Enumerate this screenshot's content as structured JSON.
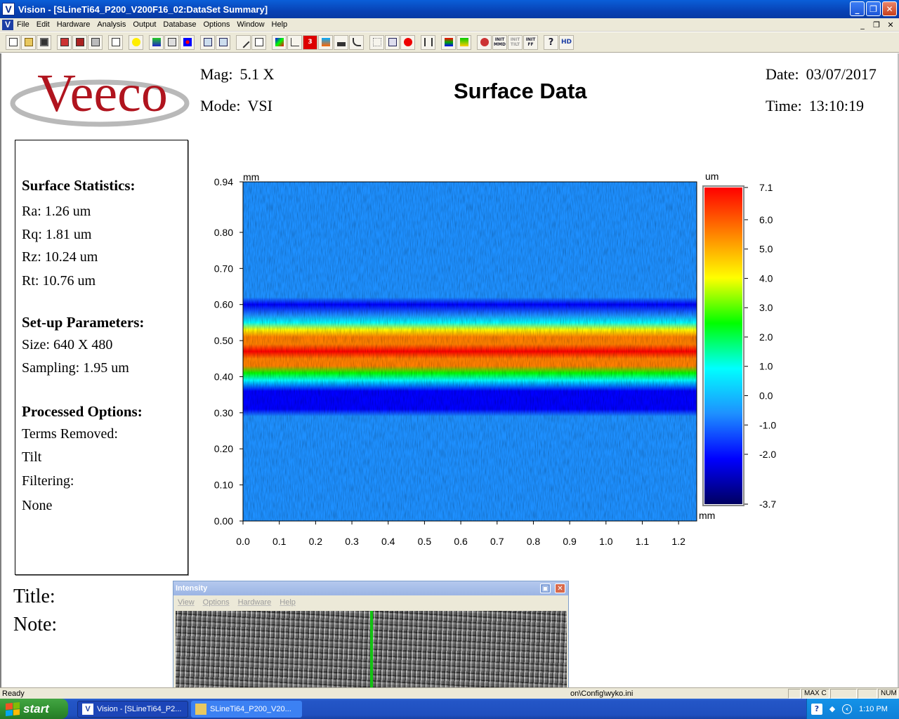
{
  "window": {
    "app_icon": "V",
    "title": "Vision - [SLineTi64_P200_V200F16_02:DataSet Summary]",
    "buttons": {
      "minimize": "_",
      "maximize": "❐",
      "close": "✕"
    }
  },
  "menubar": {
    "items": [
      "File",
      "Edit",
      "Hardware",
      "Analysis",
      "Output",
      "Database",
      "Options",
      "Window",
      "Help"
    ],
    "mdi": {
      "minimize": "_",
      "restore": "❐",
      "close": "✕"
    }
  },
  "toolbar": {
    "text_buttons": {
      "three_d": "3",
      "init_mmd": "INIT MMD",
      "init_tilt": "INIT TILT",
      "init_ff": "INIT FF",
      "help": "?",
      "hd": "HD"
    }
  },
  "report": {
    "logo_text": "Veeco",
    "mag_label": "Mag:",
    "mag_value": "5.1 X",
    "mode_label": "Mode:",
    "mode_value": "VSI",
    "title": "Surface Data",
    "date_label": "Date:",
    "date_value": "03/07/2017",
    "time_label": "Time:",
    "time_value": "13:10:19",
    "stats": {
      "heading": "Surface Statistics:",
      "ra": "Ra:  1.26 um",
      "rq": "Rq:  1.81 um",
      "rz": "Rz:  10.24 um",
      "rt": "Rt:  10.76 um"
    },
    "setup": {
      "heading": "Set-up Parameters:",
      "size": "Size: 640 X 480",
      "sampling": "Sampling:  1.95 um"
    },
    "processed": {
      "heading": "Processed Options:",
      "terms_label": "Terms Removed:",
      "terms_value": "Tilt",
      "filter_label": "Filtering:",
      "filter_value": "None"
    },
    "title_label": "Title:",
    "note_label": "Note:"
  },
  "chart_data": {
    "type": "heatmap",
    "x_unit": "mm",
    "y_unit": "mm",
    "z_unit": "um",
    "xlim": [
      0,
      1.25
    ],
    "ylim": [
      0,
      0.94
    ],
    "x_ticks": [
      "0.0",
      "0.1",
      "0.2",
      "0.3",
      "0.4",
      "0.5",
      "0.6",
      "0.7",
      "0.8",
      "0.9",
      "1.0",
      "1.1",
      "1.2"
    ],
    "y_ticks": [
      "0.00",
      "0.10",
      "0.20",
      "0.30",
      "0.40",
      "0.50",
      "0.60",
      "0.70",
      "0.80",
      "0.94"
    ],
    "y_tick_values": [
      0,
      0.1,
      0.2,
      0.3,
      0.4,
      0.5,
      0.6,
      0.7,
      0.8,
      0.94
    ],
    "zlim": [
      -3.7,
      7.1
    ],
    "colorbar_ticks": [
      "7.1",
      "6.0",
      "5.0",
      "4.0",
      "3.0",
      "2.0",
      "1.0",
      "0.0",
      "-1.0",
      "-2.0",
      "-3.7"
    ],
    "colorbar_tick_values": [
      7.1,
      6.0,
      5.0,
      4.0,
      3.0,
      2.0,
      1.0,
      0.0,
      -1.0,
      -2.0,
      -3.7
    ],
    "colormap": [
      "#000060",
      "#0000ff",
      "#1e90ff",
      "#00ffff",
      "#00ff00",
      "#ffff00",
      "#ff8000",
      "#ff0000"
    ],
    "profile": {
      "y": [
        0.0,
        0.29,
        0.31,
        0.33,
        0.36,
        0.39,
        0.41,
        0.43,
        0.45,
        0.47,
        0.49,
        0.51,
        0.53,
        0.55,
        0.57,
        0.6,
        0.62,
        0.94
      ],
      "z": [
        0.0,
        0.0,
        -2.5,
        -2.3,
        -1.5,
        0.2,
        2.5,
        4.8,
        6.0,
        6.5,
        6.3,
        5.6,
        3.5,
        1.0,
        -1.2,
        -2.6,
        0.0,
        0.0
      ]
    }
  },
  "intensity_window": {
    "title": "Intensity",
    "menu": [
      "View",
      "Options",
      "Hardware",
      "Help"
    ],
    "buttons": {
      "pin": "▣",
      "close": "✕"
    }
  },
  "statusbar": {
    "ready": "Ready",
    "path": "on\\Config\\wyko.ini",
    "panel_max": "MAX C",
    "panel_num": "NUM"
  },
  "taskbar": {
    "start": "start",
    "tasks": [
      "Vision - [SLineTi64_P2...",
      "SLineTi64_P200_V20..."
    ],
    "clock": "1:10 PM"
  }
}
